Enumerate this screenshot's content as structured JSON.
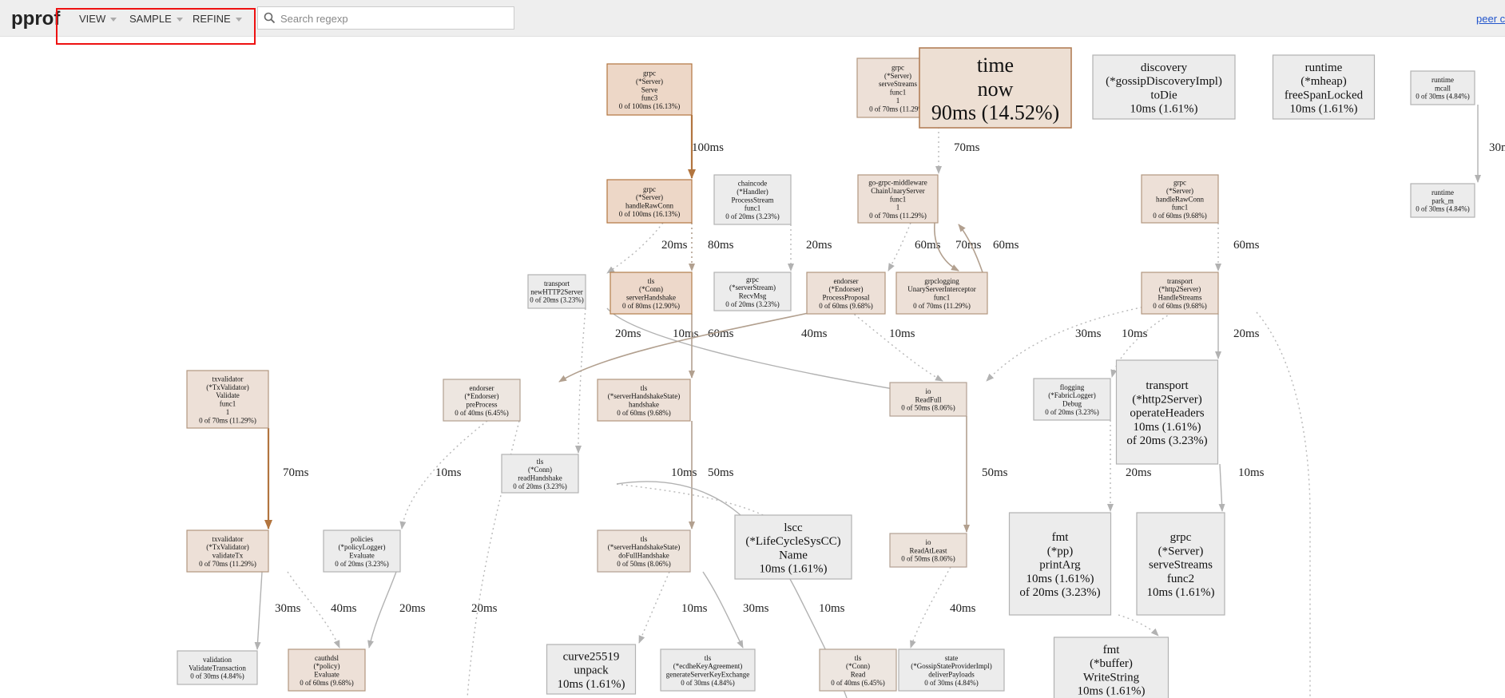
{
  "header": {
    "brand": "pprof",
    "menus": [
      {
        "label": "VIEW"
      },
      {
        "label": "SAMPLE"
      },
      {
        "label": "REFINE"
      }
    ],
    "search_placeholder": "Search regexp",
    "peer_link": "peer c"
  },
  "graph": {
    "nodes": [
      {
        "id": "serve",
        "lines": [
          "grpc",
          "(*Server)",
          "Serve",
          "func3",
          "0 of 100ms (16.13%)"
        ],
        "fill": "#edd7c7",
        "stroke": "#b2753f"
      },
      {
        "id": "handleRawConn",
        "lines": [
          "grpc",
          "(*Server)",
          "handleRawConn",
          "0 of 100ms (16.13%)"
        ],
        "fill": "#edd7c7",
        "stroke": "#b2753f"
      },
      {
        "id": "chaincode",
        "lines": [
          "chaincode",
          "(*Handler)",
          "ProcessStream",
          "func1",
          "0 of 20ms (3.23%)"
        ],
        "fill": "#ececec",
        "stroke": "#b2b2b2"
      },
      {
        "id": "serveStreams",
        "lines": [
          "grpc",
          "(*Server)",
          "serveStreams",
          "func1",
          "1",
          "0 of 70ms (11.29%)"
        ],
        "fill": "#ede0d7",
        "stroke": "#b2967f"
      },
      {
        "id": "timenow",
        "lines": [
          "time",
          "now",
          "90ms (14.52%)"
        ],
        "fill": "#eddfd3",
        "stroke": "#b27f57"
      },
      {
        "id": "discovery",
        "lines": [
          "discovery",
          "(*gossipDiscoveryImpl)",
          "toDie",
          "10ms (1.61%)"
        ],
        "fill": "#ececec",
        "stroke": "#b2b2b2"
      },
      {
        "id": "mheap",
        "lines": [
          "runtime",
          "(*mheap)",
          "freeSpanLocked",
          "10ms (1.61%)"
        ],
        "fill": "#ececec",
        "stroke": "#b2b2b2"
      },
      {
        "id": "mcall",
        "lines": [
          "runtime",
          "mcall",
          "0 of 30ms (4.84%)"
        ],
        "fill": "#ececec",
        "stroke": "#b2b2b2"
      },
      {
        "id": "parkm",
        "lines": [
          "runtime",
          "park_m",
          "0 of 30ms (4.84%)"
        ],
        "fill": "#ececec",
        "stroke": "#b2b2b2"
      },
      {
        "id": "chainUnary",
        "lines": [
          "go-grpc-middleware",
          "ChainUnaryServer",
          "func1",
          "1",
          "0 of 70ms (11.29%)"
        ],
        "fill": "#ede0d7",
        "stroke": "#b2967f"
      },
      {
        "id": "hrcFunc1",
        "lines": [
          "grpc",
          "(*Server)",
          "handleRawConn",
          "func1",
          "0 of 60ms (9.68%)"
        ],
        "fill": "#ede0d7",
        "stroke": "#b2967f"
      },
      {
        "id": "newHTTP2Server",
        "lines": [
          "transport",
          "newHTTP2Server",
          "0 of 20ms (3.23%)"
        ],
        "fill": "#ececec",
        "stroke": "#b2b2b2"
      },
      {
        "id": "serverHandshake",
        "lines": [
          "tls",
          "(*Conn)",
          "serverHandshake",
          "0 of 80ms (12.90%)"
        ],
        "fill": "#edd8ca",
        "stroke": "#b27e4b"
      },
      {
        "id": "recvMsg",
        "lines": [
          "grpc",
          "(*serverStream)",
          "RecvMsg",
          "0 of 20ms (3.23%)"
        ],
        "fill": "#ececec",
        "stroke": "#b2b2b2"
      },
      {
        "id": "processProposal",
        "lines": [
          "endorser",
          "(*Endorser)",
          "ProcessProposal",
          "0 of 60ms (9.68%)"
        ],
        "fill": "#ede0d7",
        "stroke": "#b2967f"
      },
      {
        "id": "grpclogging",
        "lines": [
          "grpclogging",
          "UnaryServerInterceptor",
          "func1",
          "0 of 70ms (11.29%)"
        ],
        "fill": "#ede0d7",
        "stroke": "#b2967f"
      },
      {
        "id": "handleStreams",
        "lines": [
          "transport",
          "(*http2Server)",
          "HandleStreams",
          "0 of 60ms (9.68%)"
        ],
        "fill": "#ede0d7",
        "stroke": "#b2967f"
      },
      {
        "id": "txvalidate",
        "lines": [
          "txvalidator",
          "(*TxValidator)",
          "Validate",
          "func1",
          "1",
          "0 of 70ms (11.29%)"
        ],
        "fill": "#ede0d7",
        "stroke": "#b2967f"
      },
      {
        "id": "preProcess",
        "lines": [
          "endorser",
          "(*Endorser)",
          "preProcess",
          "0 of 40ms (6.45%)"
        ],
        "fill": "#ede6e0",
        "stroke": "#b2a08f"
      },
      {
        "id": "handshake",
        "lines": [
          "tls",
          "(*serverHandshakeState)",
          "handshake",
          "0 of 60ms (9.68%)"
        ],
        "fill": "#ede0d7",
        "stroke": "#b2967f"
      },
      {
        "id": "readFull",
        "lines": [
          "io",
          "ReadFull",
          "0 of 50ms (8.06%)"
        ],
        "fill": "#ede3db",
        "stroke": "#b2a092"
      },
      {
        "id": "flogging",
        "lines": [
          "flogging",
          "(*FabricLogger)",
          "Debug",
          "0 of 20ms (3.23%)"
        ],
        "fill": "#ececec",
        "stroke": "#b2b2b2"
      },
      {
        "id": "operateHeaders",
        "lines": [
          "transport",
          "(*http2Server)",
          "operateHeaders",
          "10ms (1.61%)",
          "of 20ms (3.23%)"
        ],
        "fill": "#ececec",
        "stroke": "#b2b2b2"
      },
      {
        "id": "readHandshake",
        "lines": [
          "tls",
          "(*Conn)",
          "readHandshake",
          "0 of 20ms (3.23%)"
        ],
        "fill": "#ececec",
        "stroke": "#b2b2b2"
      },
      {
        "id": "validateTx",
        "lines": [
          "txvalidator",
          "(*TxValidator)",
          "validateTx",
          "0 of 70ms (11.29%)"
        ],
        "fill": "#ede0d7",
        "stroke": "#b2967f"
      },
      {
        "id": "policyEvaluate",
        "lines": [
          "policies",
          "(*policyLogger)",
          "Evaluate",
          "0 of 20ms (3.23%)"
        ],
        "fill": "#ececec",
        "stroke": "#b2b2b2"
      },
      {
        "id": "doFullHandshake",
        "lines": [
          "tls",
          "(*serverHandshakeState)",
          "doFullHandshake",
          "0 of 50ms (8.06%)"
        ],
        "fill": "#ede3db",
        "stroke": "#b2a092"
      },
      {
        "id": "lscc",
        "lines": [
          "lscc",
          "(*LifeCycleSysCC)",
          "Name",
          "10ms (1.61%)"
        ],
        "fill": "#ececec",
        "stroke": "#b2b2b2"
      },
      {
        "id": "readAtLeast",
        "lines": [
          "io",
          "ReadAtLeast",
          "0 of 50ms (8.06%)"
        ],
        "fill": "#ede3db",
        "stroke": "#b2a092"
      },
      {
        "id": "printArg",
        "lines": [
          "fmt",
          "(*pp)",
          "printArg",
          "10ms (1.61%)",
          "of 20ms (3.23%)"
        ],
        "fill": "#ececec",
        "stroke": "#b2b2b2"
      },
      {
        "id": "serveStreams2",
        "lines": [
          "grpc",
          "(*Server)",
          "serveStreams",
          "func2",
          "10ms (1.61%)"
        ],
        "fill": "#ececec",
        "stroke": "#b2b2b2"
      },
      {
        "id": "validationTx",
        "lines": [
          "validation",
          "ValidateTransaction",
          "0 of 30ms (4.84%)"
        ],
        "fill": "#ececec",
        "stroke": "#b2b2b2"
      },
      {
        "id": "cauthdsl",
        "lines": [
          "cauthdsl",
          "(*policy)",
          "Evaluate",
          "0 of 60ms (9.68%)"
        ],
        "fill": "#ede0d7",
        "stroke": "#b2967f"
      },
      {
        "id": "curve",
        "lines": [
          "curve25519",
          "unpack",
          "10ms (1.61%)"
        ],
        "fill": "#ececec",
        "stroke": "#b2b2b2"
      },
      {
        "id": "ecdhe",
        "lines": [
          "tls",
          "(*ecdheKeyAgreement)",
          "generateServerKeyExchange",
          "0 of 30ms (4.84%)"
        ],
        "fill": "#ececec",
        "stroke": "#b2b2b2"
      },
      {
        "id": "tlsRead",
        "lines": [
          "tls",
          "(*Conn)",
          "Read",
          "0 of 40ms (6.45%)"
        ],
        "fill": "#ede6e0",
        "stroke": "#b2a08f"
      },
      {
        "id": "gossipState",
        "lines": [
          "state",
          "(*GossipStateProviderImpl)",
          "deliverPayloads",
          "0 of 30ms (4.84%)"
        ],
        "fill": "#ececec",
        "stroke": "#b2b2b2"
      },
      {
        "id": "writeString",
        "lines": [
          "fmt",
          "(*buffer)",
          "WriteString",
          "10ms (1.61%)"
        ],
        "fill": "#ececec",
        "stroke": "#b2b2b2"
      }
    ],
    "edges": [
      {
        "id": "e-serve-hrc",
        "from": "serve",
        "to": "handleRawConn",
        "label": "100ms"
      },
      {
        "id": "e-ss-cu",
        "from": "serveStreams",
        "to": "chainUnary",
        "label": "70ms"
      },
      {
        "id": "e-mcall-park",
        "from": "mcall",
        "to": "parkm",
        "label": "30m"
      },
      {
        "id": "e-hrc-newh2",
        "from": "handleRawConn",
        "to": "newHTTP2Server",
        "label": "20ms"
      },
      {
        "id": "e-hrc-shs",
        "from": "handleRawConn",
        "to": "serverHandshake",
        "label": "80ms"
      },
      {
        "id": "e-cc-recv",
        "from": "chaincode",
        "to": "recvMsg",
        "label": "20ms"
      },
      {
        "id": "e-cu-pp",
        "from": "chainUnary",
        "to": "processProposal",
        "label": "60ms"
      },
      {
        "id": "e-cu-gl",
        "from": "chainUnary",
        "to": "grpclogging",
        "label": "70ms"
      },
      {
        "id": "e-gl-cu",
        "from": "grpclogging",
        "to": "chainUnary",
        "label": "60ms"
      },
      {
        "id": "e-hrcf1-hs",
        "from": "hrcFunc1",
        "to": "handleStreams",
        "label": "60ms"
      },
      {
        "id": "e-newh2-rh",
        "from": "newHTTP2Server",
        "to": "readHandshake",
        "label": "20ms"
      },
      {
        "id": "e-newh2-rf",
        "from": "newHTTP2Server",
        "to": "readFull",
        "label": "10ms"
      },
      {
        "id": "e-shs-hs",
        "from": "serverHandshake",
        "to": "handshake",
        "label": "60ms"
      },
      {
        "id": "e-pp-pre",
        "from": "processProposal",
        "to": "preProcess",
        "label": "40ms"
      },
      {
        "id": "e-pp-rf",
        "from": "processProposal",
        "to": "readFull",
        "label": "10ms"
      },
      {
        "id": "e-hs-rf",
        "from": "handleStreams",
        "to": "readFull",
        "label": "30ms"
      },
      {
        "id": "e-hs-flog",
        "from": "handleStreams",
        "to": "flogging",
        "label": "10ms"
      },
      {
        "id": "e-hs-op",
        "from": "handleStreams",
        "to": "operateHeaders",
        "label": "20ms"
      },
      {
        "id": "e-txv-vtx",
        "from": "txvalidate",
        "to": "validateTx",
        "label": "70ms"
      },
      {
        "id": "e-pre-pol",
        "from": "preProcess",
        "to": "policyEvaluate",
        "label": "10ms"
      },
      {
        "id": "e-rh-lscc",
        "from": "readHandshake",
        "to": "lscc",
        "label": "10ms"
      },
      {
        "id": "e-hsk-dfh",
        "from": "handshake",
        "to": "doFullHandshake",
        "label": "50ms"
      },
      {
        "id": "e-rf-ral",
        "from": "readFull",
        "to": "readAtLeast",
        "label": "50ms"
      },
      {
        "id": "e-flog-pa",
        "from": "flogging",
        "to": "printArg",
        "label": "20ms"
      },
      {
        "id": "e-op-ss2",
        "from": "operateHeaders",
        "to": "serveStreams2",
        "label": "10ms"
      },
      {
        "id": "e-vtx-val",
        "from": "validateTx",
        "to": "validationTx",
        "label": "30ms"
      },
      {
        "id": "e-vtx-ca",
        "from": "validateTx",
        "to": "cauthdsl",
        "label": "40ms"
      },
      {
        "id": "e-pol-ca",
        "from": "policyEvaluate",
        "to": "cauthdsl",
        "label": "20ms"
      },
      {
        "id": "e-pre-down",
        "from": "preProcess",
        "to": "offscreen",
        "label": "20ms"
      },
      {
        "id": "e-dfh-curve",
        "from": "doFullHandshake",
        "to": "curve",
        "label": "10ms"
      },
      {
        "id": "e-dfh-ecdhe",
        "from": "doFullHandshake",
        "to": "ecdhe",
        "label": "30ms"
      },
      {
        "id": "e-rh-down",
        "from": "readHandshake",
        "to": "offscreen",
        "label": "10ms"
      },
      {
        "id": "e-ral-read",
        "from": "readAtLeast",
        "to": "tlsRead",
        "label": "40ms"
      },
      {
        "id": "e-hs-down",
        "from": "handleStreams",
        "to": "offscreen",
        "label": "10ms"
      },
      {
        "id": "e-pa-ws",
        "from": "printArg",
        "to": "writeString",
        "label": "10ms"
      }
    ]
  }
}
